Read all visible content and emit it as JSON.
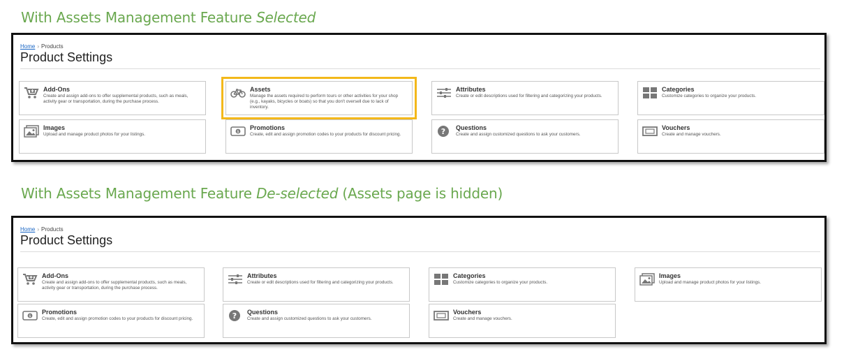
{
  "captions": {
    "selected": {
      "prefix": "With Assets Management Feature ",
      "emph": "Selected",
      "suffix": ""
    },
    "deselected": {
      "prefix": "With Assets Management Feature ",
      "emph": "De-selected",
      "suffix": " (Assets page is hidden)"
    }
  },
  "colors": {
    "caption": "#6aa84f",
    "highlight": "#f3b81a",
    "link": "#1a66c4"
  },
  "panel1": {
    "breadcrumb": {
      "home": "Home",
      "sep": "›",
      "current": "Products"
    },
    "title": "Product Settings",
    "cards": [
      {
        "icon": "cart-plus-icon",
        "title": "Add-Ons",
        "desc": "Create and assign add-ons to offer supplemental products, such as meals, activity gear or transportation, during the purchase process."
      },
      {
        "icon": "bicycle-icon",
        "title": "Assets",
        "desc": "Manage the assets required to perform tours or other activities for your shop (e.g., kayaks, bicycles or boats) so that you don't oversell due to lack of inventory.",
        "highlighted": true
      },
      {
        "icon": "sliders-icon",
        "title": "Attributes",
        "desc": "Create or edit descriptions used for filtering and categorizing your products."
      },
      {
        "icon": "grid-icon",
        "title": "Categories",
        "desc": "Customize categories to organize your products."
      },
      {
        "icon": "image-icon",
        "title": "Images",
        "desc": "Upload and manage product photos for your listings."
      },
      {
        "icon": "ticket-icon",
        "title": "Promotions",
        "desc": "Create, edit and assign promotion codes to your products for discount pricing."
      },
      {
        "icon": "question-icon",
        "title": "Questions",
        "desc": "Create and assign customized questions to ask your customers."
      },
      {
        "icon": "voucher-icon",
        "title": "Vouchers",
        "desc": "Create and manage vouchers."
      }
    ]
  },
  "panel2": {
    "breadcrumb": {
      "home": "Home",
      "sep": "›",
      "current": "Products"
    },
    "title": "Product Settings",
    "cards": [
      {
        "icon": "cart-plus-icon",
        "title": "Add-Ons",
        "desc": "Create and assign add-ons to offer supplemental products, such as meals, activity gear or transportation, during the purchase process."
      },
      {
        "icon": "sliders-icon",
        "title": "Attributes",
        "desc": "Create or edit descriptions used for filtering and categorizing your products."
      },
      {
        "icon": "grid-icon",
        "title": "Categories",
        "desc": "Customize categories to organize your products."
      },
      {
        "icon": "image-icon",
        "title": "Images",
        "desc": "Upload and manage product photos for your listings."
      },
      {
        "icon": "ticket-icon",
        "title": "Promotions",
        "desc": "Create, edit and assign promotion codes to your products for discount pricing."
      },
      {
        "icon": "question-icon",
        "title": "Questions",
        "desc": "Create and assign customized questions to ask your customers."
      },
      {
        "icon": "voucher-icon",
        "title": "Vouchers",
        "desc": "Create and manage vouchers."
      }
    ]
  }
}
